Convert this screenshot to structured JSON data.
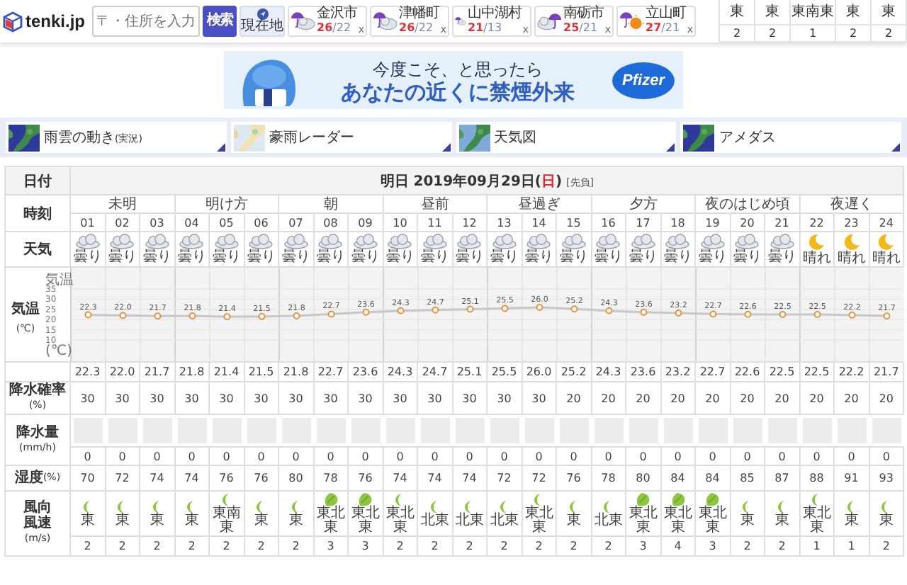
{
  "header": {
    "logo": "tenki.jp",
    "search": {
      "placeholder": "〒・住所を入力"
    },
    "search_button": "検索",
    "location_button": "現在地",
    "cities": [
      {
        "name": "金沢市",
        "high": "26",
        "low": "/22",
        "kind": "umbrella_cloud",
        "close": "x"
      },
      {
        "name": "津幡町",
        "high": "26",
        "low": "/22",
        "kind": "umbrella_cloud",
        "close": "x"
      },
      {
        "name": "山中湖村",
        "high": "21",
        "low": "/13",
        "kind": "umbrella_cloud",
        "close": "x"
      },
      {
        "name": "南砺市",
        "high": "25",
        "low": "/21",
        "kind": "cloud_umbrella",
        "close": "x"
      },
      {
        "name": "立山町",
        "high": "27",
        "low": "/21",
        "kind": "umbrella_sun",
        "close": "x"
      }
    ],
    "wind_strip": {
      "directions": [
        "東",
        "東",
        "東南東",
        "東",
        "東"
      ],
      "speeds": [
        "2",
        "2",
        "1",
        "2",
        "2"
      ]
    }
  },
  "ad": {
    "line1": "今度こそ、と思ったら",
    "line2": "あなたの近くに禁煙外来",
    "brand": "Pfizer"
  },
  "map_tabs": [
    {
      "label": "雨雲の動き",
      "note": "(実況)"
    },
    {
      "label": "豪雨レーダー"
    },
    {
      "label": "天気図"
    },
    {
      "label": "アメダス"
    }
  ],
  "forecast": {
    "labels": {
      "date": "日付",
      "time": "時刻",
      "weather": "天気",
      "temp": "気温",
      "temp_unit": "(℃)",
      "pop": "降水確率",
      "pop_unit": "(%)",
      "precip": "降水量",
      "precip_unit": "(mm/h)",
      "humidity": "湿度",
      "humidity_unit": "(%)",
      "wind_dir": "風向",
      "wind_speed": "風速",
      "wind_unit": "(m/s)"
    },
    "date": "明日 2019年09月29日(",
    "weekday": "日",
    "date_end": ")",
    "rokuyo": "[先負]",
    "periods": [
      "未明",
      "明け方",
      "朝",
      "昼前",
      "昼過ぎ",
      "夕方",
      "夜のはじめ頃",
      "夜遅く"
    ],
    "hours": [
      {
        "hour": "01",
        "kind": "cloudy",
        "weather": "曇り",
        "temp": "22.3",
        "pop": "30",
        "precip": "0",
        "humidity": "70",
        "wind": "東",
        "strong": false,
        "speed": "2"
      },
      {
        "hour": "02",
        "kind": "cloudy",
        "weather": "曇り",
        "temp": "22.0",
        "pop": "30",
        "precip": "0",
        "humidity": "72",
        "wind": "東",
        "strong": false,
        "speed": "2"
      },
      {
        "hour": "03",
        "kind": "cloudy",
        "weather": "曇り",
        "temp": "21.7",
        "pop": "30",
        "precip": "0",
        "humidity": "74",
        "wind": "東",
        "strong": false,
        "speed": "2"
      },
      {
        "hour": "04",
        "kind": "cloudy",
        "weather": "曇り",
        "temp": "21.8",
        "pop": "30",
        "precip": "0",
        "humidity": "74",
        "wind": "東",
        "strong": false,
        "speed": "2"
      },
      {
        "hour": "05",
        "kind": "cloudy",
        "weather": "曇り",
        "temp": "21.4",
        "pop": "30",
        "precip": "0",
        "humidity": "76",
        "wind": "東南東",
        "strong": false,
        "speed": "2"
      },
      {
        "hour": "06",
        "kind": "cloudy",
        "weather": "曇り",
        "temp": "21.5",
        "pop": "30",
        "precip": "0",
        "humidity": "76",
        "wind": "東",
        "strong": false,
        "speed": "2"
      },
      {
        "hour": "07",
        "kind": "cloudy",
        "weather": "曇り",
        "temp": "21.8",
        "pop": "30",
        "precip": "0",
        "humidity": "80",
        "wind": "東",
        "strong": false,
        "speed": "2"
      },
      {
        "hour": "08",
        "kind": "cloudy",
        "weather": "曇り",
        "temp": "22.7",
        "pop": "30",
        "precip": "0",
        "humidity": "78",
        "wind": "東北東",
        "strong": true,
        "speed": "3"
      },
      {
        "hour": "09",
        "kind": "cloudy",
        "weather": "曇り",
        "temp": "23.6",
        "pop": "30",
        "precip": "0",
        "humidity": "76",
        "wind": "東北東",
        "strong": true,
        "speed": "3"
      },
      {
        "hour": "10",
        "kind": "cloudy",
        "weather": "曇り",
        "temp": "24.3",
        "pop": "30",
        "precip": "0",
        "humidity": "74",
        "wind": "東北東",
        "strong": false,
        "speed": "2"
      },
      {
        "hour": "11",
        "kind": "cloudy",
        "weather": "曇り",
        "temp": "24.7",
        "pop": "30",
        "precip": "0",
        "humidity": "74",
        "wind": "北東",
        "strong": false,
        "speed": "2"
      },
      {
        "hour": "12",
        "kind": "cloudy",
        "weather": "曇り",
        "temp": "25.1",
        "pop": "30",
        "precip": "0",
        "humidity": "74",
        "wind": "北東",
        "strong": false,
        "speed": "2"
      },
      {
        "hour": "13",
        "kind": "cloudy",
        "weather": "曇り",
        "temp": "25.5",
        "pop": "30",
        "precip": "0",
        "humidity": "72",
        "wind": "北東",
        "strong": false,
        "speed": "2"
      },
      {
        "hour": "14",
        "kind": "cloudy",
        "weather": "曇り",
        "temp": "26.0",
        "pop": "30",
        "precip": "0",
        "humidity": "72",
        "wind": "東北東",
        "strong": false,
        "speed": "2"
      },
      {
        "hour": "15",
        "kind": "cloudy",
        "weather": "曇り",
        "temp": "25.2",
        "pop": "20",
        "precip": "0",
        "humidity": "76",
        "wind": "東",
        "strong": false,
        "speed": "2"
      },
      {
        "hour": "16",
        "kind": "cloudy",
        "weather": "曇り",
        "temp": "24.3",
        "pop": "20",
        "precip": "0",
        "humidity": "78",
        "wind": "北東",
        "strong": false,
        "speed": "2"
      },
      {
        "hour": "17",
        "kind": "cloudy",
        "weather": "曇り",
        "temp": "23.6",
        "pop": "20",
        "precip": "0",
        "humidity": "80",
        "wind": "東北東",
        "strong": true,
        "speed": "3"
      },
      {
        "hour": "18",
        "kind": "cloudy",
        "weather": "曇り",
        "temp": "23.2",
        "pop": "20",
        "precip": "0",
        "humidity": "84",
        "wind": "東北東",
        "strong": true,
        "speed": "4"
      },
      {
        "hour": "19",
        "kind": "cloudy",
        "weather": "曇り",
        "temp": "22.7",
        "pop": "20",
        "precip": "0",
        "humidity": "84",
        "wind": "東北東",
        "strong": true,
        "speed": "3"
      },
      {
        "hour": "20",
        "kind": "cloudy",
        "weather": "曇り",
        "temp": "22.6",
        "pop": "20",
        "precip": "0",
        "humidity": "85",
        "wind": "東",
        "strong": false,
        "speed": "2"
      },
      {
        "hour": "21",
        "kind": "cloudy",
        "weather": "曇り",
        "temp": "22.5",
        "pop": "20",
        "precip": "0",
        "humidity": "87",
        "wind": "東",
        "strong": false,
        "speed": "2"
      },
      {
        "hour": "22",
        "kind": "clear_night",
        "weather": "晴れ",
        "temp": "22.5",
        "pop": "20",
        "precip": "0",
        "humidity": "88",
        "wind": "東北東",
        "strong": false,
        "speed": "1"
      },
      {
        "hour": "23",
        "kind": "clear_night",
        "weather": "晴れ",
        "temp": "22.2",
        "pop": "20",
        "precip": "0",
        "humidity": "91",
        "wind": "東",
        "strong": false,
        "speed": "1"
      },
      {
        "hour": "24",
        "kind": "clear_night",
        "weather": "晴れ",
        "temp": "21.7",
        "pop": "20",
        "precip": "0",
        "humidity": "93",
        "wind": "東",
        "strong": false,
        "speed": "2"
      }
    ],
    "chart_data": {
      "type": "line",
      "ylim": [
        -0.5,
        45.5
      ],
      "ylabel": "気温",
      "yticks": [
        35,
        30,
        25,
        20,
        15,
        10
      ],
      "annotations": [
        {
          "text": "(℃)"
        }
      ],
      "grid": true,
      "value_labels": [
        "22.3",
        "22.0",
        "21.7",
        "21.8",
        "21.4",
        "21.5",
        "21.8",
        "22.7",
        "23.6",
        "24.3",
        "24.7",
        "25.1",
        "25.5",
        "26.0",
        "25.2",
        "24.3",
        "23.6",
        "23.2",
        "22.7",
        "22.6",
        "22.5",
        "22.5",
        "22.2",
        "21.7"
      ],
      "series": [
        {
          "color": "#e8923a",
          "marker": true,
          "values": [
            22.3,
            22.0,
            21.7,
            21.8,
            21.4,
            21.5,
            21.8,
            22.7,
            23.6,
            24.3,
            24.7,
            25.1,
            25.5,
            26.0,
            25.2,
            24.3,
            23.6,
            23.2,
            22.7,
            22.6,
            22.5,
            22.5,
            22.2,
            21.7
          ]
        }
      ]
    }
  }
}
